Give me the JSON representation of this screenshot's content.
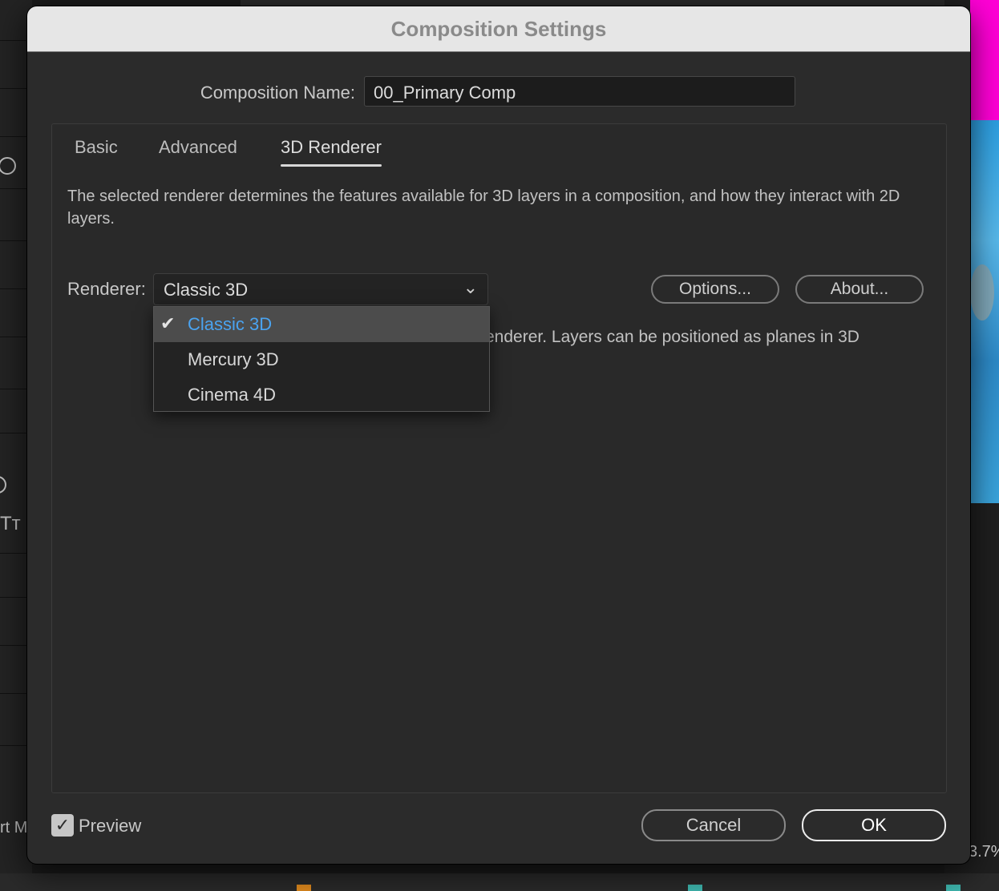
{
  "background": {
    "left_text": "Tт",
    "bottom_left_text": "rt M",
    "zoom_text": "3.7%"
  },
  "dialog": {
    "title": "Composition Settings",
    "name_label": "Composition Name:",
    "name_value": "00_Primary Comp",
    "tabs": [
      {
        "label": "Basic"
      },
      {
        "label": "Advanced"
      },
      {
        "label": "3D Renderer"
      }
    ],
    "active_tab": "3D Renderer",
    "description": "The selected renderer determines the features available for 3D layers in a composition, and how they interact with 2D layers.",
    "renderer_label": "Renderer:",
    "renderer_value": "Classic 3D",
    "options_button": "Options...",
    "about_button": "About...",
    "renderer_info_partial": "enderer. Layers can be positioned as planes in 3D",
    "dropdown": {
      "items": [
        {
          "label": "Classic 3D",
          "selected": true
        },
        {
          "label": "Mercury 3D",
          "selected": false
        },
        {
          "label": "Cinema 4D",
          "selected": false
        }
      ]
    },
    "preview_label": "Preview",
    "preview_checked": true,
    "cancel_button": "Cancel",
    "ok_button": "OK"
  },
  "colors": {
    "selected_item_text": "#4aa3f0",
    "accent_magenta": "#ff00d6"
  },
  "icons": {
    "check": "checkmark-icon",
    "chevron": "chevron-down-icon"
  }
}
